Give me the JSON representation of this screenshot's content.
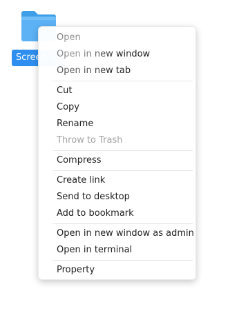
{
  "desktop_icon": {
    "label": "Screen",
    "icon": "folder-icon",
    "icon_color": "#5cb2f5",
    "selection_color": "#2f8ff0"
  },
  "context_menu": {
    "groups": [
      [
        {
          "label": "Open",
          "enabled": true
        },
        {
          "label": "Open in new window",
          "enabled": true
        },
        {
          "label": "Open in new tab",
          "enabled": true
        }
      ],
      [
        {
          "label": "Cut",
          "enabled": true
        },
        {
          "label": "Copy",
          "enabled": true
        },
        {
          "label": "Rename",
          "enabled": true
        },
        {
          "label": "Throw to Trash",
          "enabled": false
        }
      ],
      [
        {
          "label": "Compress",
          "enabled": true
        }
      ],
      [
        {
          "label": "Create link",
          "enabled": true
        },
        {
          "label": "Send to desktop",
          "enabled": true
        },
        {
          "label": "Add to bookmark",
          "enabled": true
        }
      ],
      [
        {
          "label": "Open in new window as admin",
          "enabled": true
        },
        {
          "label": "Open in terminal",
          "enabled": true
        }
      ],
      [
        {
          "label": "Property",
          "enabled": true
        }
      ]
    ]
  }
}
